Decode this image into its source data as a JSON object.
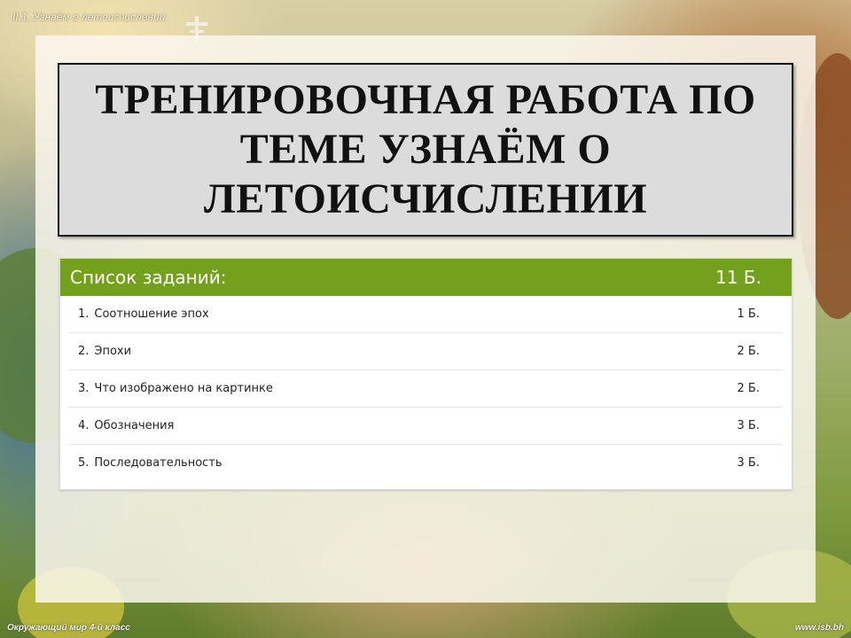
{
  "slide": {
    "header_label": "II.1. Узнаём о летоисчислении",
    "title": "ТРЕНИРОВОЧНАЯ РАБОТА ПО ТЕМЕ УЗНАЁМ О ЛЕТОИСЧИСЛЕНИИ",
    "footer_left": "Окружающий мир 4-й класс",
    "footer_right": "www.isb.bh"
  },
  "task_card": {
    "heading": "Список заданий:",
    "total_points": "11 Б.",
    "accent_color": "#74a11d",
    "tasks": [
      {
        "number": "1.",
        "name": "Соотношение эпох",
        "points": "1 Б."
      },
      {
        "number": "2.",
        "name": "Эпохи",
        "points": "2 Б."
      },
      {
        "number": "3.",
        "name": "Что изображено на картинке",
        "points": "2 Б."
      },
      {
        "number": "4.",
        "name": "Обозначения",
        "points": "3 Б."
      },
      {
        "number": "5.",
        "name": "Последовательность",
        "points": "3 Б."
      }
    ]
  }
}
